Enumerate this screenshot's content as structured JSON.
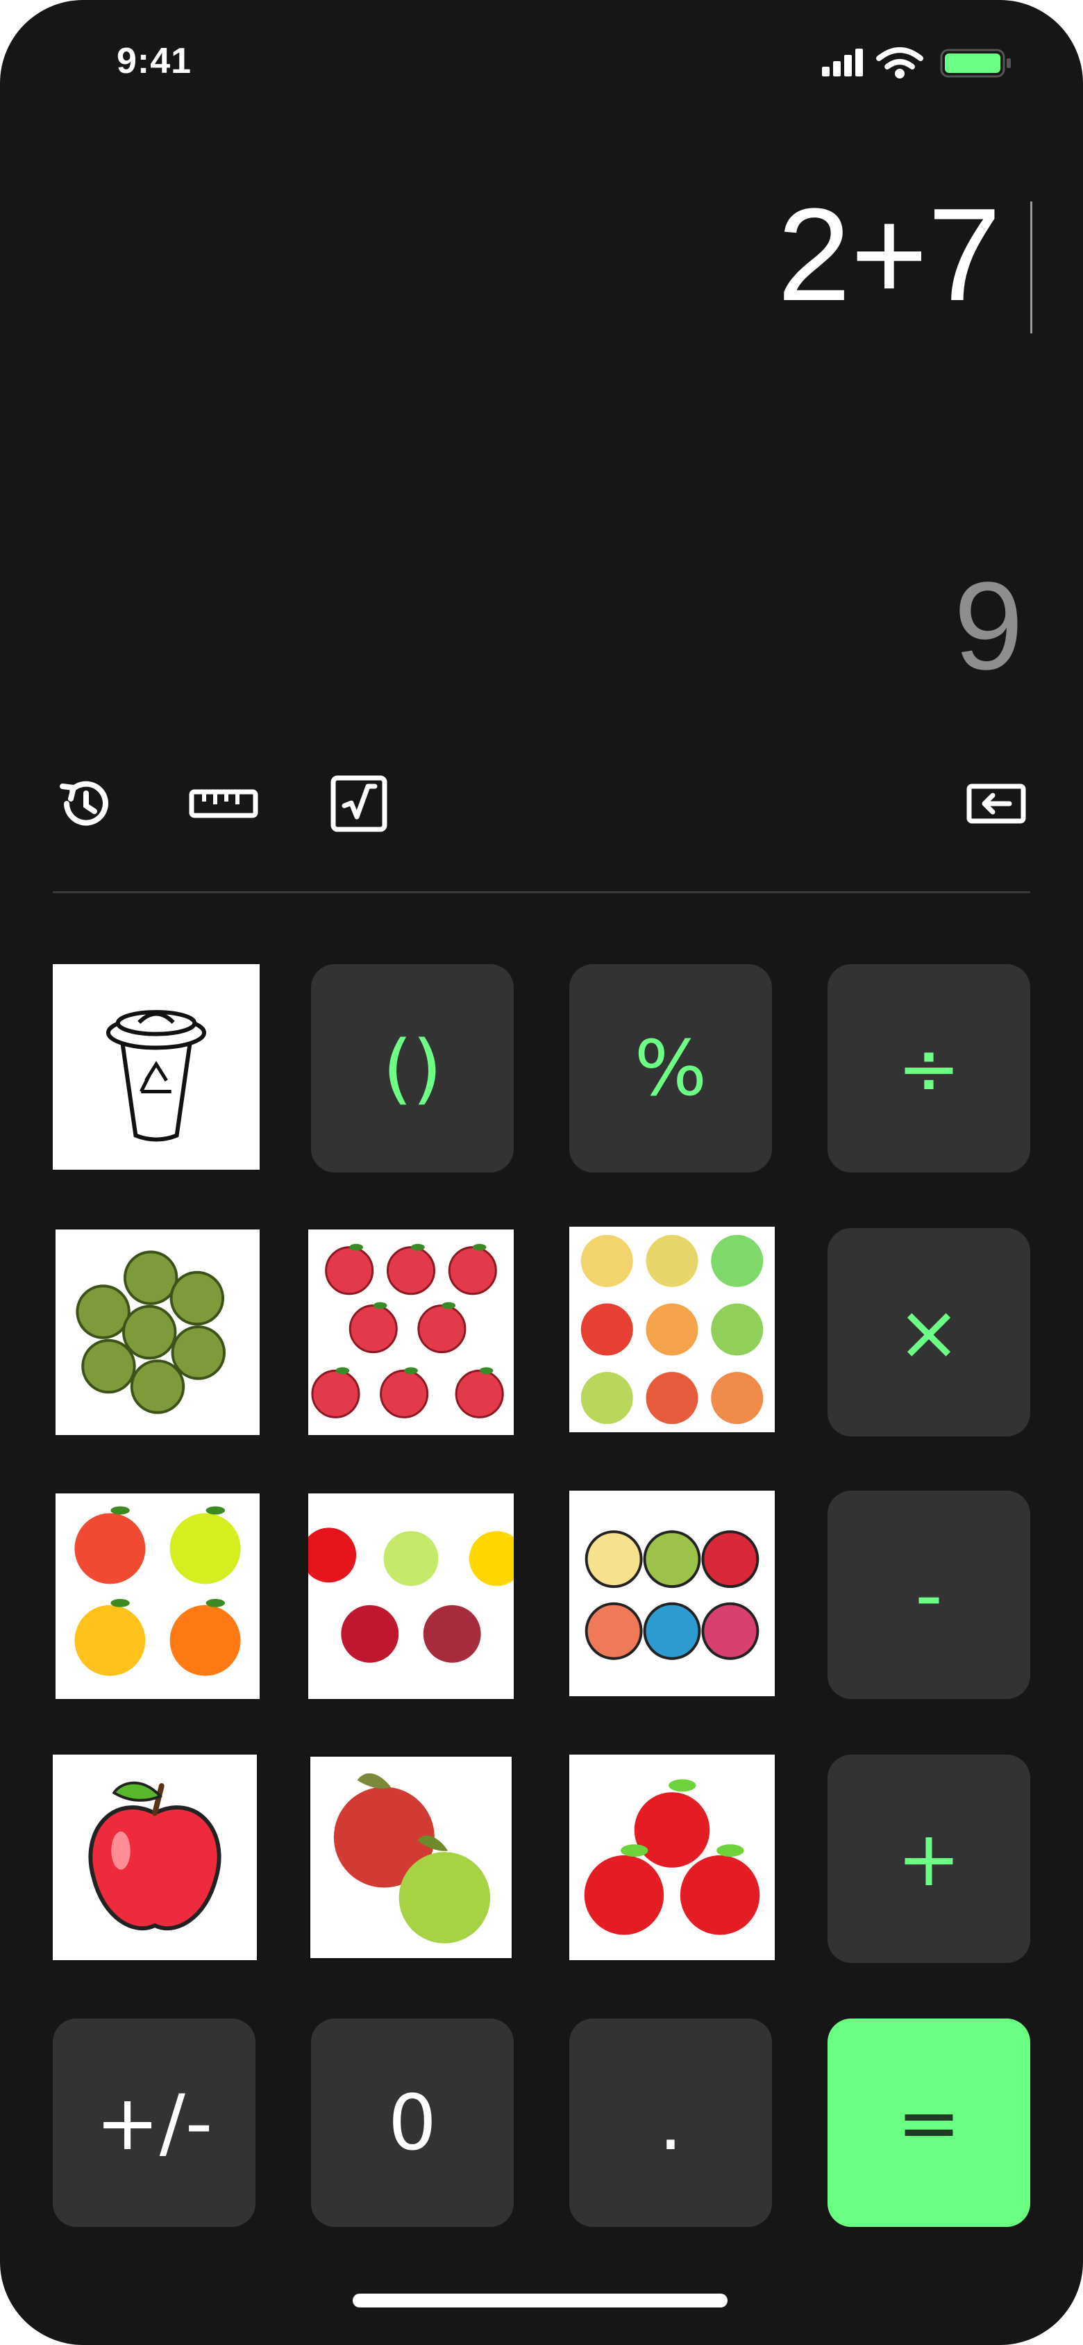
{
  "status_bar": {
    "time": "9:41",
    "icons": [
      "signal-icon",
      "wifi-icon",
      "battery-icon"
    ]
  },
  "display": {
    "expression": "2+7",
    "result": "9"
  },
  "toolbar": {
    "icons": [
      "history-icon",
      "ruler-icon",
      "sqrt-icon",
      "backspace-icon"
    ]
  },
  "keypad": {
    "row1": {
      "clear": "recycle-bin-image",
      "parentheses": "()",
      "percent": "%",
      "divide": "÷"
    },
    "row2": {
      "multiply": "×"
    },
    "row3": {
      "subtract": "-"
    },
    "row4": {
      "add": "+"
    },
    "row5": {
      "negate": "+/-",
      "zero": "0",
      "decimal": ".",
      "equals": "="
    }
  },
  "colors": {
    "accent": "#6bff84",
    "background": "#161616",
    "key": "#333333",
    "result": "#8e8e8e"
  }
}
